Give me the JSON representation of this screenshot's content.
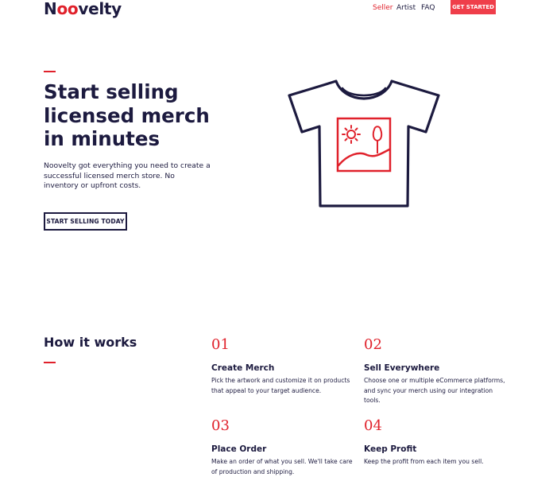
{
  "header": {
    "logo": {
      "before": "N",
      "accent": "oo",
      "after": "velty"
    },
    "nav": [
      {
        "label": "Seller",
        "active": true
      },
      {
        "label": "Artist",
        "active": false
      },
      {
        "label": "FAQ",
        "active": false
      }
    ],
    "cta_label": "GET STARTED"
  },
  "hero": {
    "title_lines": [
      "Start selling",
      "licensed merch",
      "in minutes"
    ],
    "description": "Noovelty got everything you need to create a successful licensed merch store. No inventory or upfront costs.",
    "button_label": "START SELLING TODAY",
    "illustration_icon": "tshirt-artwork-icon"
  },
  "how_it_works": {
    "title": "How it works",
    "steps": [
      {
        "number": "01",
        "title": "Create Merch",
        "description": "Pick the artwork and customize it on products that appeal to your target audience."
      },
      {
        "number": "02",
        "title": "Sell Everywhere",
        "description": "Choose one or multiple eCommerce platforms, and sync your merch using our integration tools."
      },
      {
        "number": "03",
        "title": "Place Order",
        "description": "Make an order of what you sell. We'll take care of production and shipping."
      },
      {
        "number": "04",
        "title": "Keep Profit",
        "description": "Keep the profit from each item you sell."
      }
    ]
  },
  "colors": {
    "navy": "#1c1a3f",
    "brand_red": "#e0212b",
    "cta_red": "#ef3e4a"
  }
}
